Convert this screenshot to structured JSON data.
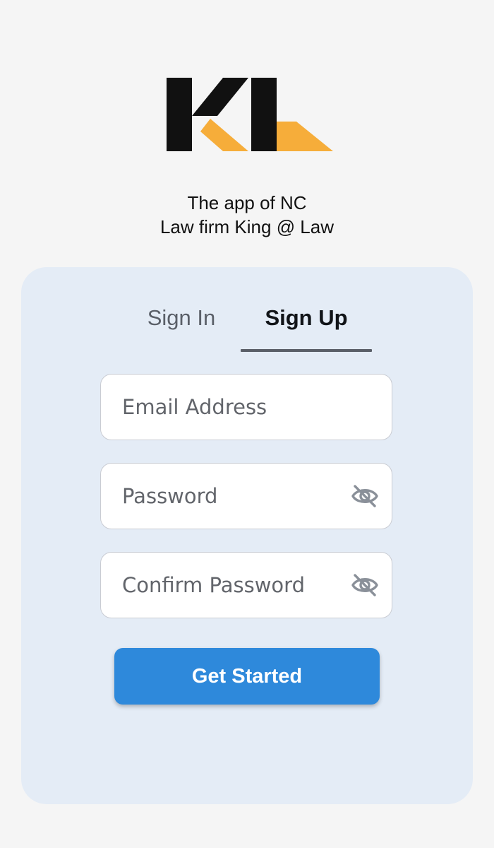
{
  "logo": {
    "name": "KL logo",
    "colors": {
      "dark": "#111111",
      "accent": "#f6ad3a"
    }
  },
  "tagline": {
    "line1": "The app of NC",
    "line2": "Law firm King @ Law"
  },
  "tabs": [
    {
      "label": "Sign In",
      "active": false
    },
    {
      "label": "Sign Up",
      "active": true
    }
  ],
  "form": {
    "email": {
      "placeholder": "Email Address",
      "value": ""
    },
    "password": {
      "placeholder": "Password",
      "value": "",
      "toggle_icon": "eye-off-icon"
    },
    "confirm_password": {
      "placeholder": "Confirm Password",
      "value": "",
      "toggle_icon": "eye-off-icon"
    },
    "submit_label": "Get Started"
  },
  "colors": {
    "background": "#f5f5f5",
    "card": "#e4ecf6",
    "primary": "#2e89db",
    "tab_active_text": "#111418",
    "tab_inactive_text": "#5a5f68"
  }
}
